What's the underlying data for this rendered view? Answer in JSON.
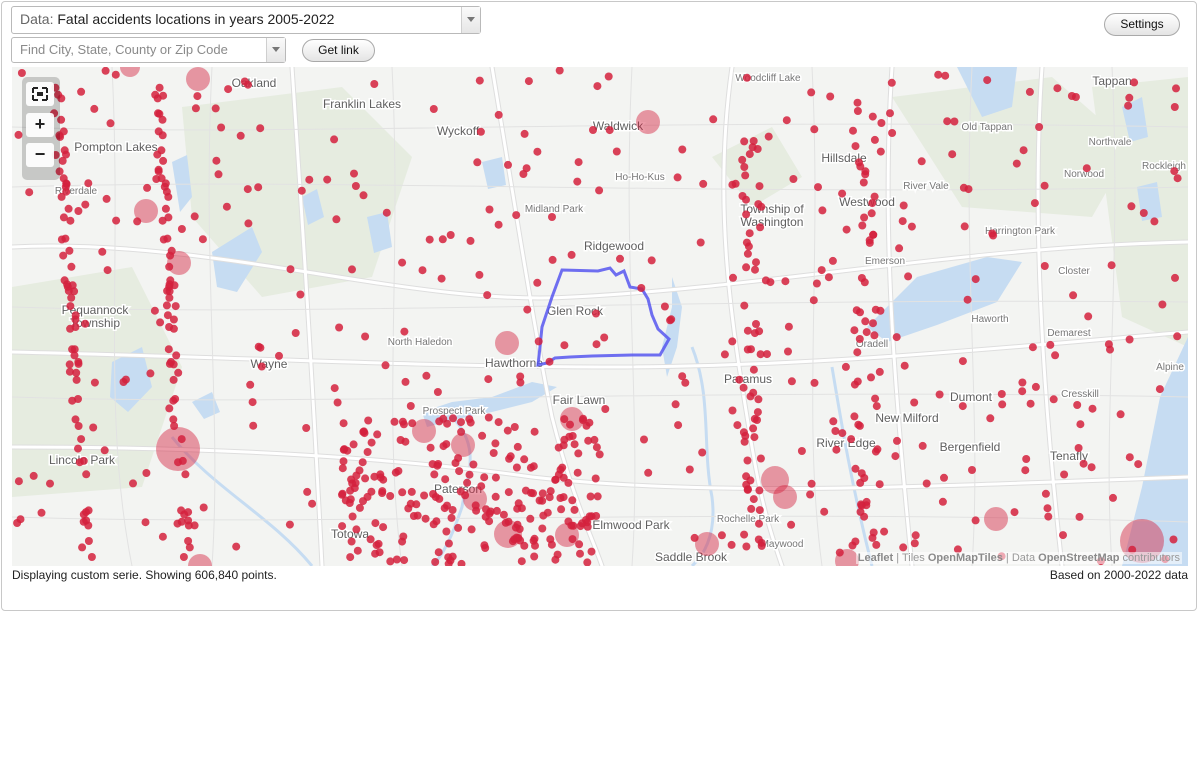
{
  "data_select": {
    "prefix": "Data:",
    "value": "Fatal accidents locations in years 2005-2022"
  },
  "search": {
    "placeholder": "Find City, State, County or Zip Code"
  },
  "buttons": {
    "get_link": "Get link",
    "settings": "Settings"
  },
  "zoom": {
    "fullscreen_icon": "fullscreen-icon",
    "in": "+",
    "out": "−"
  },
  "colors": {
    "accident": "#d4213d",
    "boundary": "#5656f0",
    "water": "#c4dcf4",
    "park": "#e4ecde",
    "road": "#ffffff"
  },
  "map": {
    "places": [
      "Oakland",
      "Franklin Lakes",
      "Wyckoff",
      "Waldwick",
      "Woodcliff Lake",
      "Tappan",
      "Pompton Lakes",
      "Ho-Ho-Kus",
      "Hillsdale",
      "Old Tappan",
      "Northvale",
      "Riverdale",
      "Midland Park",
      "Township of Washington",
      "Westwood",
      "River Vale",
      "Norwood",
      "Rockleigh",
      "Ridgewood",
      "Harrington Park",
      "Emerson",
      "Closter",
      "Glen Rock",
      "Pequannock Township",
      "Haworth",
      "Demarest",
      "North Haledon",
      "Wayne",
      "Oradell",
      "Alpine",
      "Hawthorne",
      "Paramus",
      "Dumont",
      "Cresskill",
      "Fair Lawn",
      "Prospect Park",
      "New Milford",
      "River Edge",
      "Bergenfield",
      "Lincoln Park",
      "Tenafly",
      "Paterson",
      "Rochelle Park",
      "Elmwood Park",
      "Totowa",
      "Maywood",
      "Saddle Brook"
    ],
    "attribution": {
      "leaflet": "Leaflet",
      "tiles_label": "Tiles",
      "tiles_provider": "OpenMapTiles",
      "data_label": "Data",
      "data_provider": "OpenStreetMap",
      "contributors": "contributors"
    }
  },
  "status": {
    "left": "Displaying custom serie. Showing 606,840 points.",
    "right": "Based on 2000-2022 data"
  }
}
